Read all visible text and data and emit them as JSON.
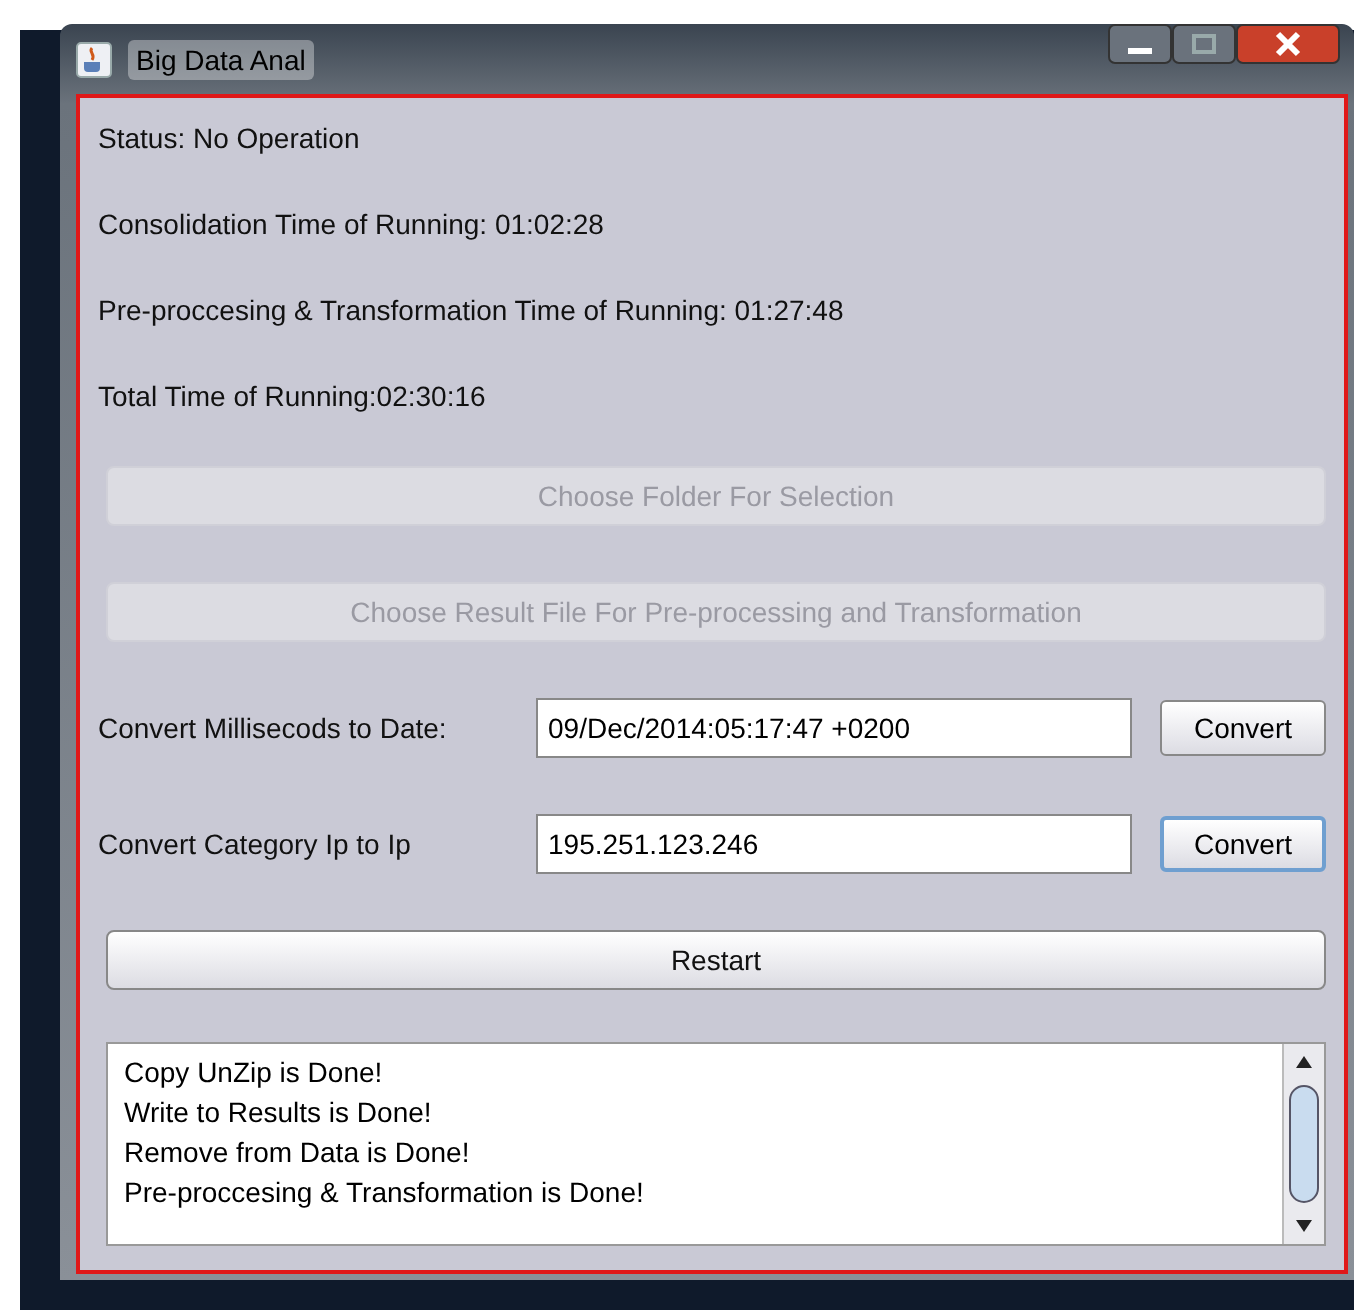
{
  "window": {
    "title": "Big Data Anal"
  },
  "status_lines": [
    "Status: No Operation",
    "Consolidation Time of Running: 01:02:28",
    "Pre-proccesing & Transformation Time of Running: 01:27:48",
    "Total Time of Running:02:30:16"
  ],
  "action_buttons": [
    {
      "label": "Choose Folder For Selection",
      "disabled": true
    },
    {
      "label": "Choose Result File For Pre-processing and Transformation",
      "disabled": true
    }
  ],
  "converters": [
    {
      "label": "Convert Millisecods to Date:",
      "value": "09/Dec/2014:05:17:47 +0200",
      "button": "Convert",
      "focused": false
    },
    {
      "label": "Convert Category Ip to Ip",
      "value": "195.251.123.246",
      "button": "Convert",
      "focused": true
    }
  ],
  "restart_button": {
    "label": "Restart",
    "disabled": false
  },
  "log": {
    "lines": [
      "Copy UnZip is Done!",
      "Write to Results is Done!",
      "Remove from Data is Done!",
      "Pre-proccesing & Transformation is Done!"
    ]
  }
}
